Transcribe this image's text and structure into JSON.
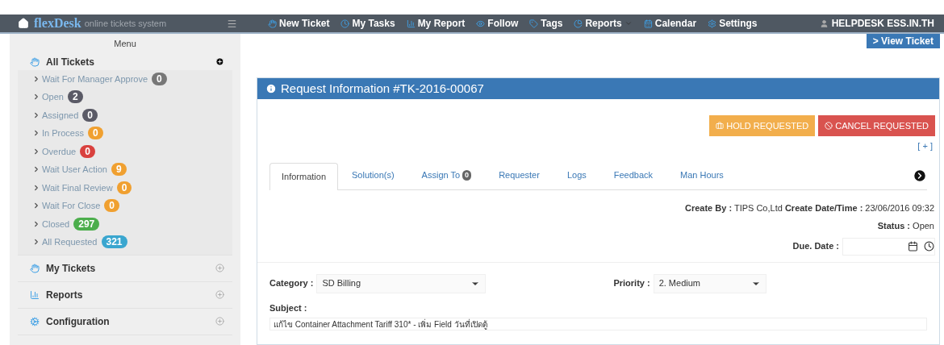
{
  "brand": {
    "name": "flexDesk",
    "tagline": "online tickets system"
  },
  "nav": [
    {
      "label": "New Ticket"
    },
    {
      "label": "My Tasks"
    },
    {
      "label": "My Report"
    },
    {
      "label": "Follow"
    },
    {
      "label": "Tags"
    },
    {
      "label": "Reports",
      "dropdown": true
    },
    {
      "label": "Calendar"
    },
    {
      "label": "Settings"
    }
  ],
  "user": "HELPDESK ESS.IN.TH",
  "breadcrumb": "> View Ticket",
  "sidebar": {
    "title": "Menu",
    "sections": [
      {
        "label": "All Tickets",
        "expanded": true,
        "children": [
          {
            "label": "Wait For Manager Approve",
            "count": "0",
            "color": "#777777"
          },
          {
            "label": "Open",
            "count": "2",
            "color": "#5a5a66"
          },
          {
            "label": "Assigned",
            "count": "0",
            "color": "#5a5a66"
          },
          {
            "label": "In Process",
            "count": "0",
            "color": "#f0a030"
          },
          {
            "label": "Overdue",
            "count": "0",
            "color": "#d9413e"
          },
          {
            "label": "Wait User Action",
            "count": "9",
            "color": "#f0a030"
          },
          {
            "label": "Wait Final Review",
            "count": "0",
            "color": "#f0a030"
          },
          {
            "label": "Wait For Close",
            "count": "0",
            "color": "#f0a030"
          },
          {
            "label": "Closed",
            "count": "297",
            "color": "#4cae4c"
          },
          {
            "label": "All Requested",
            "count": "321",
            "color": "#3aa6cf"
          }
        ]
      },
      {
        "label": "My Tickets",
        "expanded": false
      },
      {
        "label": "Reports",
        "expanded": false
      },
      {
        "label": "Configuration",
        "expanded": false
      }
    ]
  },
  "panel": {
    "title": "Request Information #TK-2016-00067",
    "buttons": [
      {
        "label": "HOLD REQUESTED",
        "kind": "hold"
      },
      {
        "label": "CANCEL REQUESTED",
        "kind": "cancel"
      }
    ],
    "tag_link": "[ + ]",
    "tabs": [
      {
        "label": "Information",
        "selected": true
      },
      {
        "label": "Solution(s)",
        "selected": false
      },
      {
        "label": "Assign To",
        "selected": false,
        "count": "0"
      },
      {
        "label": "Requester",
        "selected": false
      },
      {
        "label": "Logs",
        "selected": false
      },
      {
        "label": "Feedback",
        "selected": false
      },
      {
        "label": "Man Hours",
        "selected": false
      }
    ],
    "create_by_label": "Create By :",
    "create_by": "TIPS Co,Ltd",
    "create_date_label": "Create Date/Time :",
    "create_date": "23/06/2016 09:32",
    "status_label": "Status :",
    "status": "Open",
    "due_label": "Due. Date :",
    "category_label": "Category :",
    "category": "SD Billing",
    "priority_label": "Priority :",
    "priority": "2. Medium",
    "subject_label": "Subject :",
    "subject": "แก้ไข Container Attachment Tariff 310* - เพิ่ม Field วันที่เปิดตู้"
  }
}
